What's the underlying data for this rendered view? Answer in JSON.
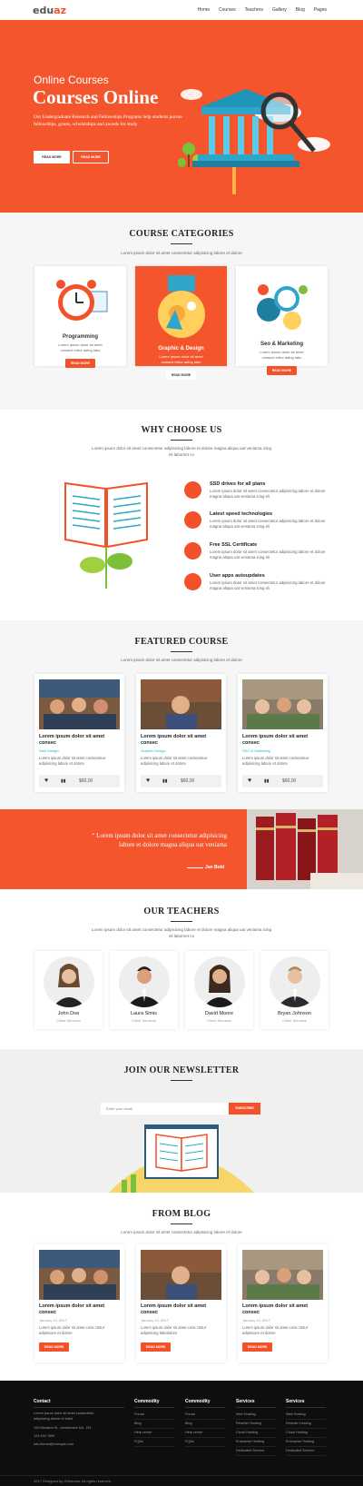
{
  "header": {
    "logo_a": "edu",
    "logo_b": "az",
    "nav": [
      "Home",
      "Courses",
      "Teachers",
      "Gallery",
      "Blog",
      "Pages"
    ]
  },
  "hero": {
    "kicker": "Online Courses",
    "title": "Courses Online",
    "text": "Our Undergraduate Research and Fellowships Programs help students pursue fellowships, grants, scholarships and awards for study",
    "btn1": "READ MORE",
    "btn2": "READ MORE"
  },
  "categories": {
    "title": "COURSE CATEGORIES",
    "sub": "Lorem ipsum dolor sit amet consectetur adipisicing labore et dolore",
    "items": [
      {
        "name": "Programming",
        "desc": "Lorem ipsum dolor sit amet consect etrtur ading labo",
        "btn": "READ MORE"
      },
      {
        "name": "Graphic & Design",
        "desc": "Lorem ipsum dolor sit amet consect etrtur ading labo",
        "btn": "READ MORE"
      },
      {
        "name": "Seo & Marketing",
        "desc": "Lorem ipsum dolor sit amet consect etrtur ading labo",
        "btn": "READ MORE"
      }
    ]
  },
  "why": {
    "title": "WHY CHOOSE US",
    "sub": "Lorem ipsum dolor sit amet consectetur adipisicing labore et dolore magna aliqua uat veniama icing eli labornet co",
    "items": [
      {
        "t": "SSD drives for all plans",
        "d": "Lorem ipsum dolor sit amet consectetur adipisicing labore et dolore magna aliqua uat veniama icing eli"
      },
      {
        "t": "Latest speed technologies",
        "d": "Lorem ipsum dolor sit amet consectetur adipisicing labore et dolore magna aliqua uat veniama icing eli"
      },
      {
        "t": "Free SSL Certificate",
        "d": "Lorem ipsum dolor sit amet consectetur adipisicing labore et dolore magna aliqua uat veniama icing eli"
      },
      {
        "t": "User apps autoupdates",
        "d": "Lorem ipsum dolor sit amet consectetur adipisicing labore et dolore magna aliqua uat veniama icing eli"
      }
    ]
  },
  "featured": {
    "title": "FEATURED COURSE",
    "sub": "Lorem ipsum dolor sit amet consectetur adipisicing labore et dolore",
    "items": [
      {
        "name": "Lorem ipsum dolor sit amet consec",
        "cat": "Web Design",
        "desc": "Lorem ipsum dolor sit amet consectetur adipisicing labore et dolore",
        "price": "$60,00"
      },
      {
        "name": "Lorem ipsum dolor sit amet consec",
        "cat": "Graphic Design",
        "desc": "Lorem ipsum dolor sit amet consectetur adipisicing labore et dolore",
        "price": "$60,00"
      },
      {
        "name": "Lorem ipsum dolor sit amet consec",
        "cat": "SEO & Marketing",
        "desc": "Lorem ipsum dolor sit amet consectetur adipisicing labore et dolore",
        "price": "$60,00"
      }
    ]
  },
  "quote": {
    "text": "“ Lorem ipsum dolor sit amet consectetur adipisicing labore et dolore magna aliqua uat veniama",
    "author": "Jan Bold"
  },
  "teachers": {
    "title": "OUR TEACHERS",
    "sub": "Lorem ipsum dolor sit amet consectetur adipisicing labore et dolore magna aliqua uat veniama icing eli labornet co",
    "items": [
      {
        "name": "John Doe",
        "role": "Client Services"
      },
      {
        "name": "Laura Simis",
        "role": "Client Services"
      },
      {
        "name": "David Moore",
        "role": "Client Services"
      },
      {
        "name": "Bryan Johnson",
        "role": "Client Services"
      }
    ]
  },
  "newsletter": {
    "title": "JOIN OUR NEWSLETTER",
    "placeholder": "Enter your email",
    "btn": "SUBSCRIBE"
  },
  "blog": {
    "title": "FROM BLOG",
    "sub": "Lorem ipsum dolor sit amet consectetur adipisicing labore et dolore",
    "items": [
      {
        "name": "Lorem ipsum dolor sit amet consec",
        "date": "January 12, 2017",
        "desc": "Lorem ipsum dolor sit amet cons ctetur adipiscure et dolore",
        "btn": "READ MORE"
      },
      {
        "name": "Lorem ipsum dolor sit amet consec",
        "date": "January 12, 2017",
        "desc": "Lorem ipsum dolor sit amet cons ctetur adipisicing labodolore",
        "btn": "READ MORE"
      },
      {
        "name": "Lorem ipsum dolor sit amet consec",
        "date": "January 12, 2017",
        "desc": "Lorem ipsum dolor sit amet cons ctetur adipiscure et dolore",
        "btn": "READ MORE"
      }
    ]
  },
  "footer": {
    "contact": {
      "h": "Contact",
      "l1": "Lorem ipsum dolor sit amet consectetur",
      "l2": "adipisicing labore et trdtol",
      "addr": "100 Madison St., Amsterdam NA, 131",
      "phone": "123 456 7890",
      "email": "info.theme@example.com"
    },
    "c2": {
      "h": "Commodity",
      "items": [
        "Forum",
        "Blog",
        "Help center",
        "FQAs"
      ]
    },
    "c3": {
      "h": "Commodity",
      "items": [
        "Forum",
        "Blog",
        "Help center",
        "FQAs"
      ]
    },
    "c4": {
      "h": "Services",
      "items": [
        "Web Hosting",
        "Reseller Hosting",
        "Cloud Hosting",
        "Enterprise Hosting",
        "Dedicated Servers"
      ]
    },
    "c5": {
      "h": "Services",
      "items": [
        "Web Hosting",
        "Reseller Hosting",
        "Cloud Hosting",
        "Enterprise Hosting",
        "Dedicated Servers"
      ]
    },
    "copy": "2017 Designed by Orthemes. All rights reserved"
  },
  "colors": {
    "accent": "#f4552c",
    "dark": "#0e0e0e",
    "link": "#1cb5d8"
  }
}
